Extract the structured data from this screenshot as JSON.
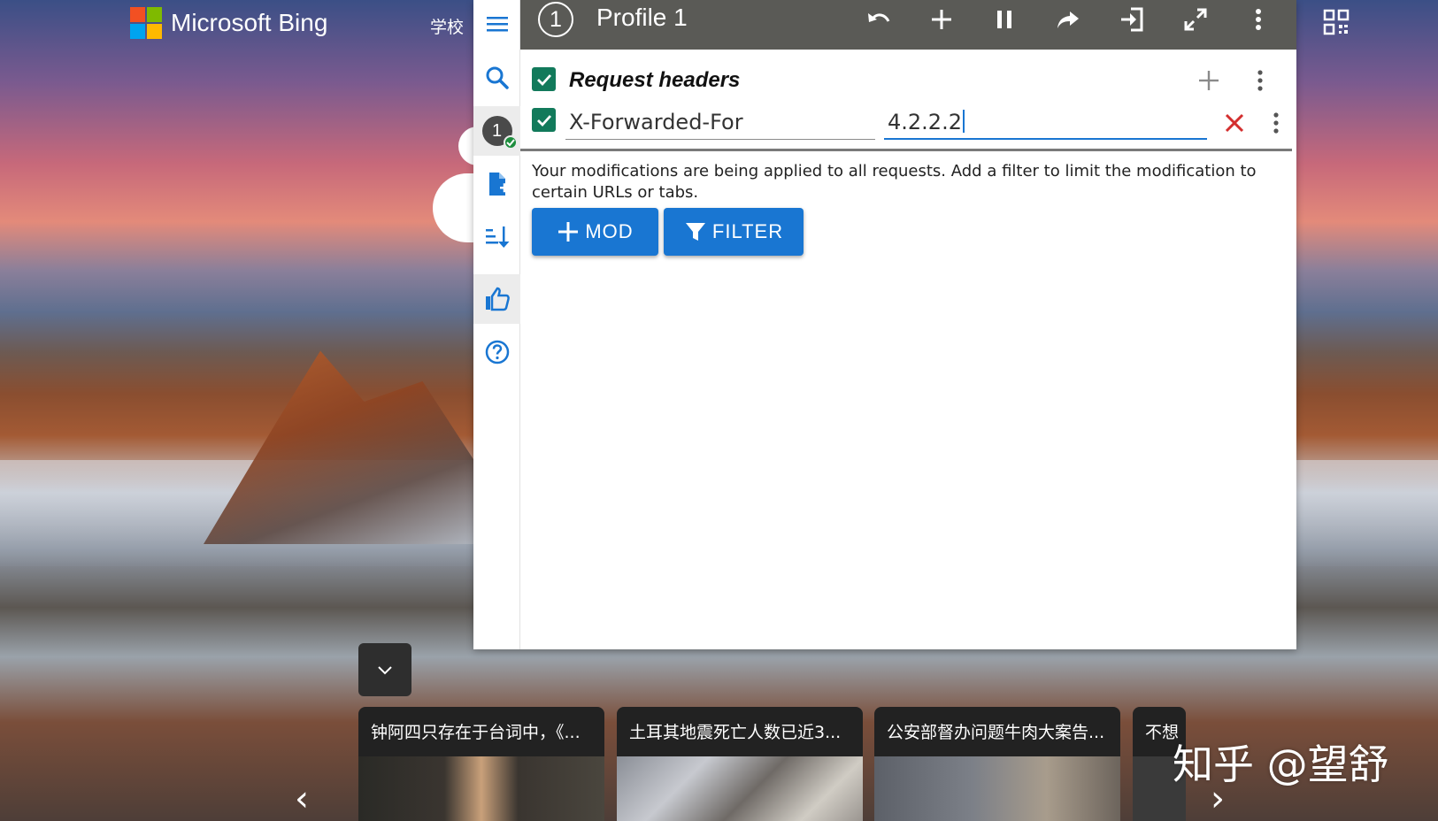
{
  "bing": {
    "brand": "Microsoft Bing",
    "nav_item": "学校",
    "logo_colors": [
      "#f25022",
      "#7fba00",
      "#00a4ef",
      "#ffb900"
    ]
  },
  "extension": {
    "profile_number": "1",
    "profile_name": "Profile 1",
    "section_title": "Request headers",
    "header_name": "X-Forwarded-For",
    "header_value": "4.2.2.2",
    "notice": "Your modifications are being applied to all requests. Add a filter to limit the modification to certain URLs or tabs.",
    "buttons": {
      "mod": "MOD",
      "filter": "FILTER"
    },
    "sidebar_profile_badge": "1",
    "colors": {
      "accent": "#1976d2",
      "topbar": "#5a5a56",
      "checkbox": "#127a5b",
      "delete": "#d32f2f"
    }
  },
  "news": [
    {
      "title": "钟阿四只存在于台词中，《..."
    },
    {
      "title": "土耳其地震死亡人数已近3..."
    },
    {
      "title": "公安部督办问题牛肉大案告..."
    },
    {
      "title": "不想"
    }
  ],
  "watermark": "知乎 @望舒"
}
